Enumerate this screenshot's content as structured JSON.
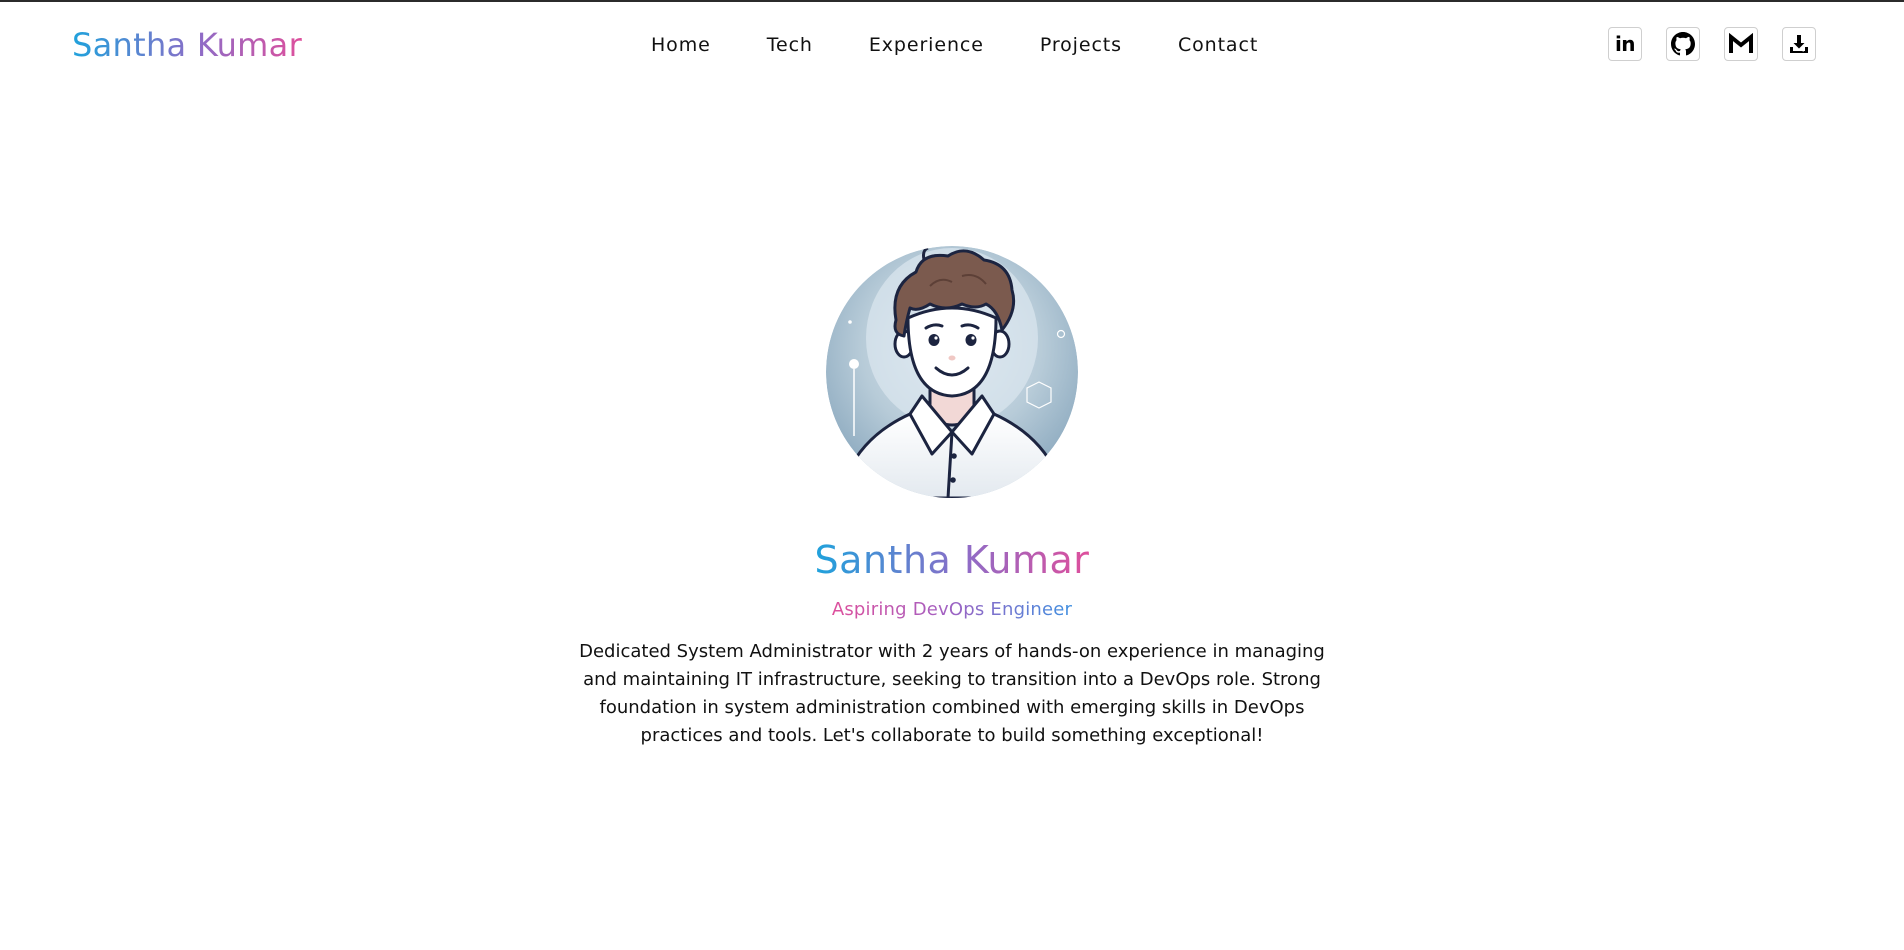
{
  "brand": {
    "name": "Santha Kumar"
  },
  "nav": {
    "links": [
      {
        "label": "Home"
      },
      {
        "label": "Tech"
      },
      {
        "label": "Experience"
      },
      {
        "label": "Projects"
      },
      {
        "label": "Contact"
      }
    ]
  },
  "socials": {
    "linkedin_label": "in",
    "icons": [
      "linkedin-icon",
      "github-icon",
      "gmail-icon",
      "download-icon"
    ]
  },
  "hero": {
    "name": "Santha Kumar",
    "role": "Aspiring DevOps Engineer",
    "description": "Dedicated System Administrator with 2 years of hands-on experience in managing and maintaining IT infrastructure, seeking to transition into a DevOps role. Strong foundation in system administration combined with emerging skills in DevOps practices and tools. Let's collaborate to build something exceptional!"
  },
  "colors": {
    "gradient_start": "#1fa2dc",
    "gradient_mid": "#8e6cc7",
    "gradient_end": "#de4f9c",
    "text": "#111111",
    "background": "#ffffff"
  }
}
